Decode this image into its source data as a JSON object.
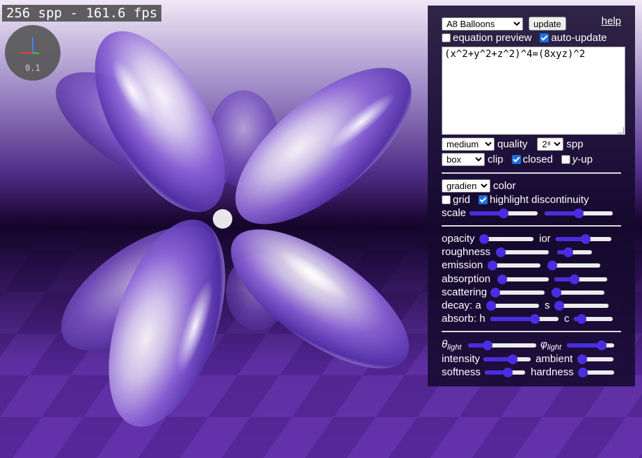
{
  "status": {
    "spp_fps": "256 spp - 161.6 fps",
    "axis_scale": "0.1"
  },
  "colors": {
    "accent": "#4a2de0",
    "panel_bg": "#140a2d",
    "surface": "#b39ddb"
  },
  "panel": {
    "preset_selected": "A8 Balloons",
    "update_label": "update",
    "help_label": "help",
    "equation_preview_label": "equation preview",
    "equation_preview_checked": false,
    "auto_update_label": "auto-update",
    "auto_update_checked": true,
    "equation": "(x^2+y^2+z^2)^4=(8xyz)^2",
    "quality_selected": "medium",
    "quality_label": "quality",
    "spp_selected": "2⁸",
    "spp_label": "spp",
    "clip_selected": "box",
    "clip_label": "clip",
    "closed_label": "closed",
    "closed_checked": true,
    "yup_label": "y",
    "yup_suffix": "-up",
    "yup_checked": false,
    "color_selected": "gradient",
    "color_label": "color",
    "grid_label": "grid",
    "grid_checked": false,
    "highlight_label": "highlight discontinuity",
    "highlight_checked": true,
    "scale_label": "scale",
    "opacity_label": "opacity",
    "ior_label": "ior",
    "roughness_label": "roughness",
    "emission_label": "emission",
    "absorption_label": "absorption",
    "scattering_label": "scattering",
    "decay_label": "decay: a",
    "s_label": "s",
    "absorb_label": "absorb: h",
    "c_label": "c",
    "theta_symbol": "θ",
    "phi_symbol": "φ",
    "light_sub": "light",
    "intensity_label": "intensity",
    "ambient_label": "ambient",
    "softness_label": "softness",
    "hardness_label": "hardness"
  },
  "sliders": {
    "scale_a": 0.5,
    "scale_b": 0.5,
    "opacity": 0.0,
    "ior": 0.55,
    "roughness": 0.0,
    "roughness2": 0.25,
    "emission": 0.0,
    "emission2": 0.0,
    "absorption": 0.0,
    "absorption2": 0.35,
    "scattering": 0.0,
    "scattering2": 0.0,
    "decay_a": 0.0,
    "decay_s": 0.0,
    "absorb_h": 0.68,
    "absorb_c": 0.1,
    "theta": 0.25,
    "phi": 0.8,
    "intensity": 0.65,
    "ambient": 0.0,
    "softness": 0.6,
    "hardness": 0.0
  }
}
